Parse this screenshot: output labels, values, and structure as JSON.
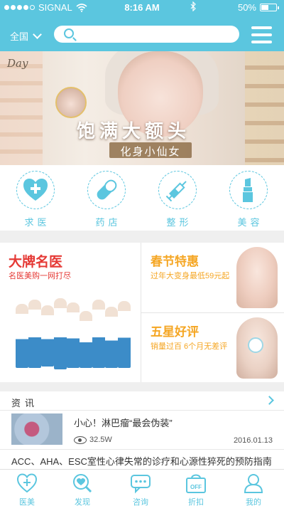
{
  "status_bar": {
    "carrier": "SIGNAL",
    "time": "8:16 AM",
    "battery": "50%",
    "battery_level": 0.5,
    "bluetooth_icon": "bluetooth-icon",
    "wifi_icon": "wifi-icon"
  },
  "header": {
    "city": "全国",
    "search_placeholder": "",
    "menu_icon": "hamburger-menu-icon"
  },
  "banner": {
    "script_text": "Day",
    "title": "饱满大额头",
    "subtitle": "化身小仙女"
  },
  "categories": [
    {
      "label": "求医",
      "icon": "heart-plus-icon"
    },
    {
      "label": "药店",
      "icon": "pill-icon"
    },
    {
      "label": "整形",
      "icon": "syringe-icon"
    },
    {
      "label": "美容",
      "icon": "lipstick-icon"
    }
  ],
  "promos": {
    "left": {
      "title": "大牌名医",
      "subtitle": "名医美购一网打尽"
    },
    "right_top": {
      "title": "春节特惠",
      "subtitle": "过年大变身最低59元起"
    },
    "right_bottom": {
      "title": "五星好评",
      "subtitle": "销量过百 6个月无差评"
    }
  },
  "news": {
    "heading": "资讯",
    "items": [
      {
        "title": "小心！淋巴瘤“最会伪装”",
        "views": "32.5W",
        "date": "2016.01.13"
      },
      {
        "title": "ACC、AHA、ESC室性心律失常的诊疗和心源性猝死的预防指南"
      }
    ]
  },
  "tabbar": [
    {
      "label": "医美",
      "icon": "heart-plus-icon"
    },
    {
      "label": "发现",
      "icon": "search-heart-icon"
    },
    {
      "label": "咨询",
      "icon": "chat-icon"
    },
    {
      "label": "折扣",
      "icon": "off-bag-icon"
    },
    {
      "label": "我的",
      "icon": "person-icon"
    }
  ],
  "colors": {
    "accent": "#5bc6df",
    "red": "#e53935",
    "orange": "#f5a623"
  }
}
